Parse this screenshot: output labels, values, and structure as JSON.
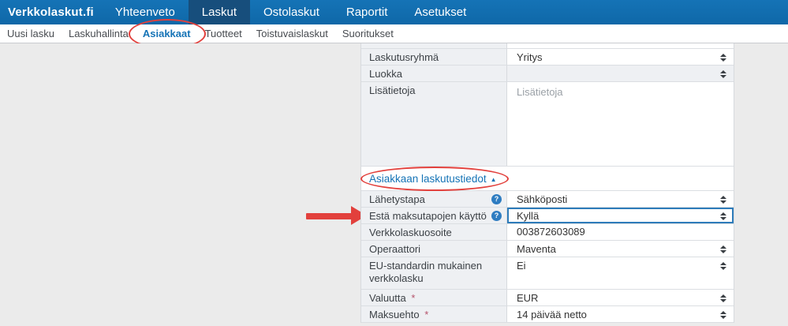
{
  "colors": {
    "navbar_bg": "#1573b6",
    "navbar_active_bg": "#174e7c",
    "link_blue": "#1573b6",
    "annotation_red": "#e2403c",
    "focus_border": "#2e7cba",
    "required_red": "#b5536b",
    "label_cell_bg": "#eef0f3"
  },
  "topnav": {
    "brand": "Verkkolaskut.fi",
    "items": [
      {
        "label": "Yhteenveto",
        "active": false
      },
      {
        "label": "Laskut",
        "active": true
      },
      {
        "label": "Ostolaskut",
        "active": false
      },
      {
        "label": "Raportit",
        "active": false
      },
      {
        "label": "Asetukset",
        "active": false
      }
    ]
  },
  "subnav": {
    "items": [
      {
        "label": "Uusi lasku",
        "active": false
      },
      {
        "label": "Laskuhallinta",
        "active": false
      },
      {
        "label": "Asiakkaat",
        "active": true,
        "circled": true
      },
      {
        "label": "Tuotteet",
        "active": false
      },
      {
        "label": "Toistuvaislaskut",
        "active": false
      },
      {
        "label": "Suoritukset",
        "active": false
      }
    ]
  },
  "form": {
    "top_rows": [
      {
        "label": "Laskutusryhmä",
        "value": "Yritys",
        "control": "select"
      },
      {
        "label": "Luokka",
        "value": "",
        "control": "select"
      },
      {
        "label": "Lisätietoja",
        "value": "",
        "placeholder": "Lisätietoja",
        "control": "textarea"
      }
    ],
    "section": {
      "title": "Asiakkaan laskutustiedot",
      "collapse_caret": "▲"
    },
    "billing_rows": [
      {
        "label": "Lähetystapa",
        "value": "Sähköposti",
        "control": "select",
        "help": true
      },
      {
        "label": "Estä maksutapojen käyttö",
        "value": "Kyllä",
        "control": "select",
        "help": true,
        "focused": true
      },
      {
        "label": "Verkkolaskuosoite",
        "value": "003872603089",
        "control": "text"
      },
      {
        "label": "Operaattori",
        "value": "Maventa",
        "control": "select"
      },
      {
        "label": "EU-standardin mukainen verkkolasku",
        "value": "Ei",
        "control": "select"
      },
      {
        "label": "Valuutta",
        "value": "EUR",
        "control": "select",
        "required": true
      },
      {
        "label": "Maksuehto",
        "value": "14 päivää netto",
        "control": "select",
        "required": true
      }
    ],
    "required_marker": "*",
    "help_icon_glyph": "?"
  }
}
